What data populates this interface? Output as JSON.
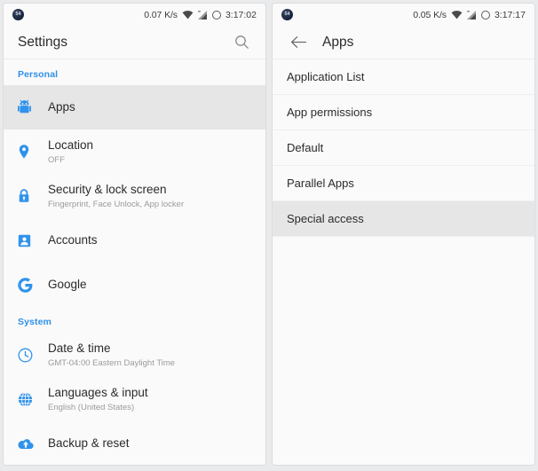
{
  "left": {
    "statusbar": {
      "badge": "54",
      "badge_icon": "app-badge-icon",
      "net_speed": "0.07 K/s",
      "wifi_icon": "wifi-icon",
      "signal_icon": "cellular-signal-icon",
      "ring_icon": "circle-ring-icon",
      "time": "3:17:02"
    },
    "appbar": {
      "title": "Settings",
      "search_icon": "search-icon"
    },
    "sections": [
      {
        "header": "Personal",
        "items": [
          {
            "icon": "android-robot-icon",
            "title": "Apps",
            "sub": "",
            "selected": true
          },
          {
            "icon": "location-pin-icon",
            "title": "Location",
            "sub": "OFF",
            "selected": false
          },
          {
            "icon": "lock-icon",
            "title": "Security & lock screen",
            "sub": "Fingerprint, Face Unlock, App locker",
            "selected": false
          },
          {
            "icon": "account-person-icon",
            "title": "Accounts",
            "sub": "",
            "selected": false
          },
          {
            "icon": "google-g-icon",
            "title": "Google",
            "sub": "",
            "selected": false
          }
        ]
      },
      {
        "header": "System",
        "items": [
          {
            "icon": "clock-icon",
            "title": "Date & time",
            "sub": "GMT-04:00 Eastern Daylight Time",
            "selected": false
          },
          {
            "icon": "globe-icon",
            "title": "Languages & input",
            "sub": "English (United States)",
            "selected": false
          },
          {
            "icon": "cloud-upload-icon",
            "title": "Backup & reset",
            "sub": "",
            "selected": false
          }
        ]
      }
    ]
  },
  "right": {
    "statusbar": {
      "badge": "54",
      "badge_icon": "app-badge-icon",
      "net_speed": "0.05 K/s",
      "wifi_icon": "wifi-icon",
      "signal_icon": "cellular-signal-icon",
      "ring_icon": "circle-ring-icon",
      "time": "3:17:17"
    },
    "appbar": {
      "back_icon": "back-arrow-icon",
      "title": "Apps"
    },
    "items": [
      {
        "label": "Application List",
        "selected": false
      },
      {
        "label": "App permissions",
        "selected": false
      },
      {
        "label": "Default",
        "selected": false
      },
      {
        "label": "Parallel Apps",
        "selected": false
      },
      {
        "label": "Special access",
        "selected": true
      }
    ]
  },
  "colors": {
    "accent_blue": "#2f93ec",
    "section_header_blue": "#2f8fe8",
    "selected_row": "#e6e6e6",
    "panel_bg": "#fafafa",
    "page_bg": "#e9eaec"
  }
}
